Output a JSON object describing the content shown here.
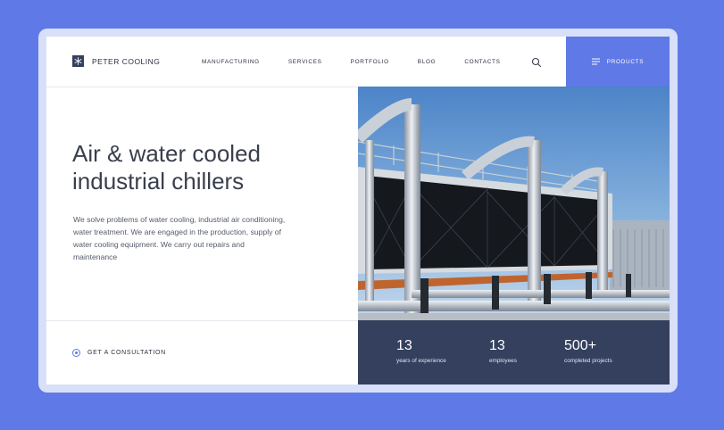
{
  "brand": {
    "name": "PETER COOLING"
  },
  "nav": {
    "items": [
      "MANUFACTURING",
      "SERVICES",
      "PORTFOLIO",
      "BLOG",
      "CONTACTS"
    ]
  },
  "header": {
    "products_label": "PRODUCTS"
  },
  "hero": {
    "title_line1": "Air & water cooled",
    "title_line2": "industrial chillers",
    "description": "We solve problems of water cooling, industrial air conditioning, water treatment. We are engaged in the production, supply of water cooling equipment. We carry out repairs and maintenance",
    "cta_label": "GET A CONSULTATION"
  },
  "stats": [
    {
      "value": "13",
      "label": "years of experience"
    },
    {
      "value": "13",
      "label": "employees"
    },
    {
      "value": "500+",
      "label": "completed projects"
    }
  ],
  "colors": {
    "accent": "#5f79e6",
    "navy": "#34405e",
    "text": "#3a3f4d",
    "background": "#5f79e6"
  },
  "icons": {
    "logo": "snowflake-icon",
    "search": "search-icon",
    "menu": "menu-lines-icon",
    "cta": "radio-dot-icon"
  }
}
